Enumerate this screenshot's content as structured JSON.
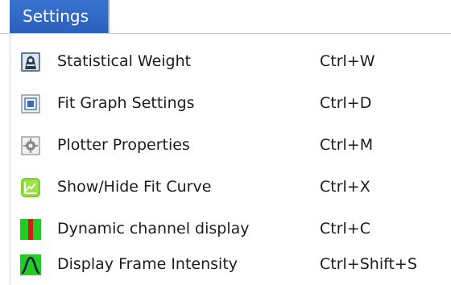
{
  "menu": {
    "title": "Settings",
    "items": [
      {
        "label": "Statistical Weight",
        "shortcut": "Ctrl+W",
        "icon": "statistical-weight-icon"
      },
      {
        "label": "Fit Graph Settings",
        "shortcut": "Ctrl+D",
        "icon": "fit-graph-settings-icon"
      },
      {
        "label": "Plotter Properties",
        "shortcut": "Ctrl+M",
        "icon": "plotter-properties-icon"
      },
      {
        "label": "Show/Hide Fit Curve",
        "shortcut": "Ctrl+X",
        "icon": "fit-curve-icon"
      },
      {
        "label": "Dynamic channel display",
        "shortcut": "Ctrl+C",
        "icon": "dynamic-channel-icon"
      },
      {
        "label": "Display Frame Intensity",
        "shortcut": "Ctrl+Shift+S",
        "icon": "frame-intensity-icon"
      }
    ]
  },
  "colors": {
    "menu_title_bg": "#2f66c6",
    "green": "#22cc22",
    "red": "#d81818"
  }
}
